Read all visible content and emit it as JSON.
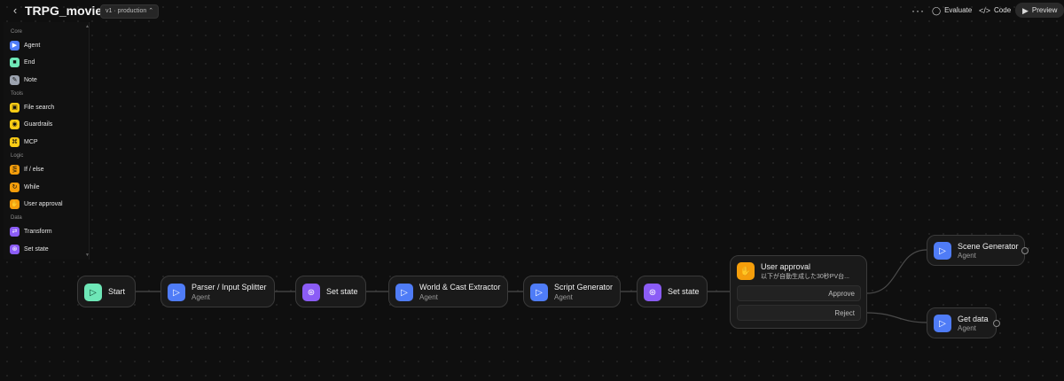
{
  "header": {
    "title": "TRPG_movie_test",
    "version": "v1 · production ⌃",
    "evaluate": "Evaluate",
    "code": "Code",
    "preview": "Preview"
  },
  "palette": {
    "sections": {
      "core": "Core",
      "tools": "Tools",
      "logic": "Logic",
      "data": "Data"
    },
    "items": {
      "agent": "Agent",
      "end": "End",
      "note": "Note",
      "file_search": "File search",
      "guardrails": "Guardrails",
      "mcp": "MCP",
      "if_else": "If / else",
      "while": "While",
      "user_approval": "User approval",
      "transform": "Transform",
      "set_state": "Set state"
    }
  },
  "nodes": {
    "start": "Start",
    "parser": {
      "title": "Parser / Input Splitter",
      "sub": "Agent"
    },
    "set_state1": "Set state",
    "world": {
      "title": "World & Cast Extractor",
      "sub": "Agent"
    },
    "script": {
      "title": "Script Generator",
      "sub": "Agent"
    },
    "set_state2": "Set state",
    "approval": {
      "title": "User approval",
      "sub": "以下が自動生成した30秒PV台...",
      "approve": "Approve",
      "reject": "Reject"
    },
    "scene": {
      "title": "Scene Generator",
      "sub": "Agent"
    },
    "getdata": {
      "title": "Get data",
      "sub": "Agent"
    }
  },
  "colors": {
    "agent": "#4f7cf7",
    "start": "#6ee7b7",
    "set_state": "#8b5cf6",
    "user_approval": "#f59e0b"
  }
}
